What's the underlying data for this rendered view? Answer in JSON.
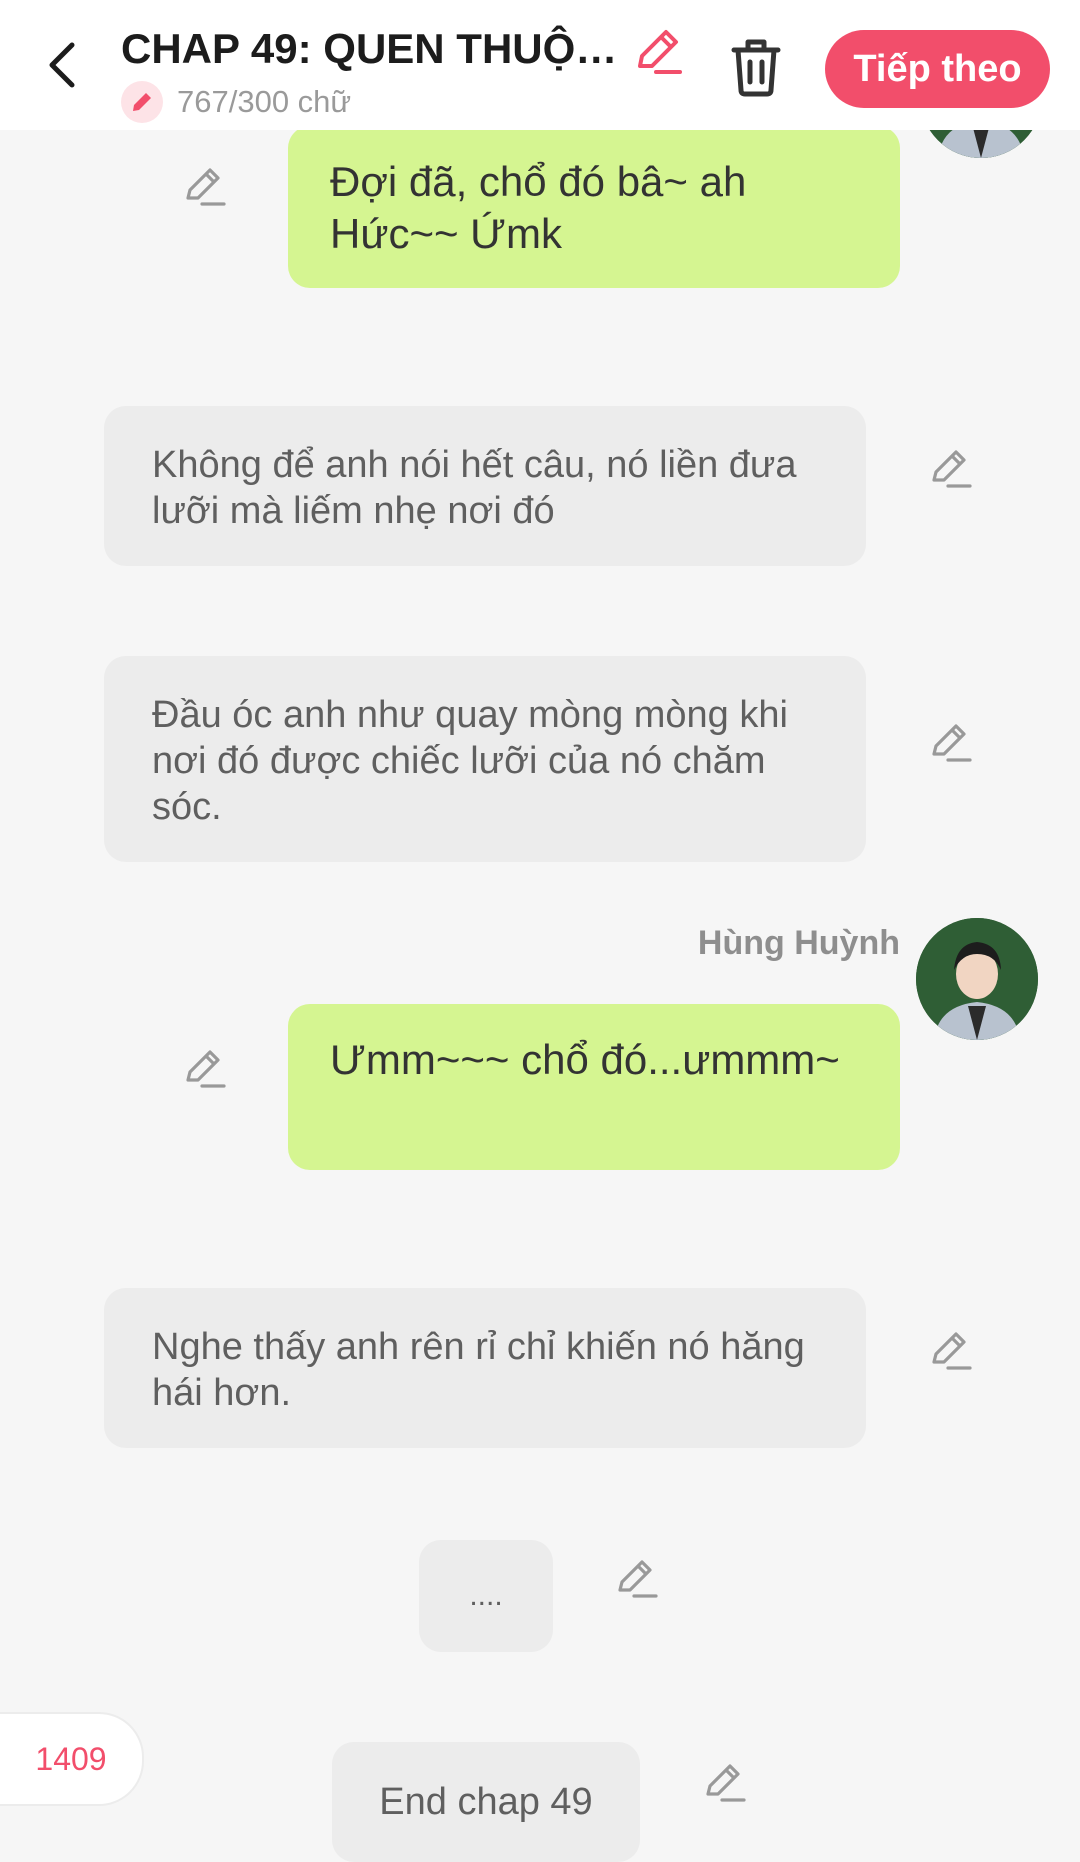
{
  "header": {
    "title": "CHAP 49: QUEN THUỘC...",
    "word_count": "767/300 chữ",
    "next_label": "Tiếp theo"
  },
  "messages": [
    {
      "type": "character",
      "speaker": "",
      "text": "Đợi đã, chổ đó bâ~ ah Hức~~ Ứmk"
    },
    {
      "type": "narration",
      "text": "Không để anh nói hết câu, nó liền đưa lưỡi mà liếm nhẹ nơi đó"
    },
    {
      "type": "narration",
      "text": "Đầu óc anh như quay mòng mòng khi nơi đó được chiếc lưỡi của nó chăm sóc."
    },
    {
      "type": "character",
      "speaker": "Hùng Huỳnh",
      "text": "Ưmm~~~ chổ đó...ưmmm~"
    },
    {
      "type": "narration",
      "text": "Nghe thấy anh rên rỉ chỉ khiến nó hăng hái hơn."
    },
    {
      "type": "narration",
      "text": "...."
    },
    {
      "type": "narration",
      "text": "End chap 49"
    }
  ],
  "counter": "1409",
  "colors": {
    "accent": "#f24e6b",
    "character_bubble": "#d5f591",
    "narration_bubble": "#ececec",
    "background": "#f6f6f6"
  },
  "icons": [
    "back-arrow-icon",
    "pencil-icon",
    "trash-icon",
    "avatar"
  ]
}
